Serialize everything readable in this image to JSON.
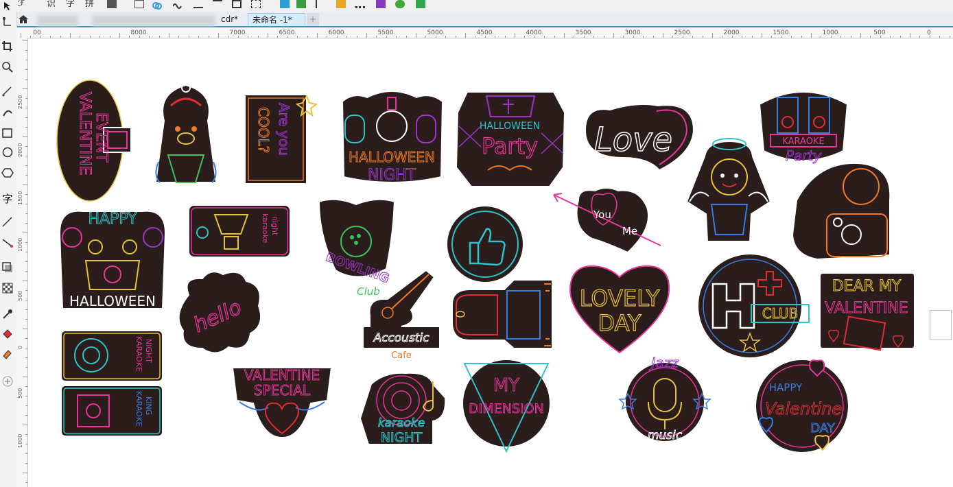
{
  "tabs": [
    {
      "label": "cdr*",
      "active": false
    },
    {
      "label": "未命名 -1*",
      "active": true
    }
  ],
  "toolbar_text": [
    "识",
    "字",
    "拼"
  ],
  "ruler": {
    "labels": [
      "00",
      "8000",
      "7000",
      "6500",
      "6000",
      "5500",
      "5000",
      "4500",
      "4000",
      "3500",
      "3000",
      "2500",
      "2000",
      "1500",
      "1000",
      "500",
      "0"
    ],
    "v_labels": [
      "2500",
      "2000",
      "1500",
      "1000",
      "500",
      "0",
      "500",
      "1000"
    ]
  },
  "stickers": {
    "valentine_event": [
      "VALENTINE",
      "EVENT"
    ],
    "are_you_cool": [
      "Are you",
      "COOL?"
    ],
    "halloween_night": [
      "HALLOWEEN",
      "NIGHT"
    ],
    "halloween_party": [
      "HALLOWEEN",
      "Party"
    ],
    "love": "Love",
    "karaoke_party": [
      "KARAOKE",
      "Party"
    ],
    "happy_halloween": [
      "HAPPY",
      "HALLOWEEN"
    ],
    "karaoke_night_ticket": [
      "karaoke",
      "night"
    ],
    "bowling": [
      "BOWLING",
      "Club"
    ],
    "you_me": [
      "You",
      "Me"
    ],
    "hello": "hello",
    "acoustic": [
      "Accoustic",
      "Cafe"
    ],
    "lovely_day": [
      "LOVELY",
      "DAY"
    ],
    "h_club": "CLUB",
    "dear_valentine": [
      "DEAR MY",
      "VALENTINE"
    ],
    "karaoke_ticket": [
      "KARAOKE",
      "NIGHT"
    ],
    "karaoke_king": [
      "KARAOKE",
      "KING"
    ],
    "valentine_special": [
      "VALENTINE",
      "SPECIAL"
    ],
    "karaoke_night": [
      "karaoke",
      "NIGHT"
    ],
    "my_dimension": [
      "MY",
      "DIMENSION"
    ],
    "jazz_music": [
      "Jazz",
      "music"
    ],
    "happy_valentine_day": [
      "HAPPY",
      "Valentine",
      "DAY"
    ]
  },
  "colors": {
    "sticker_fill": "#2a1d1b",
    "pink": "#e8359a",
    "purple": "#9b35c9",
    "yellow": "#e8c23a",
    "orange": "#ef7a28",
    "cyan": "#2ec4c9",
    "red": "#e02d33",
    "green": "#3ec25a",
    "blue": "#3a7de0",
    "active_tab_accent": "#2d9cd8"
  }
}
